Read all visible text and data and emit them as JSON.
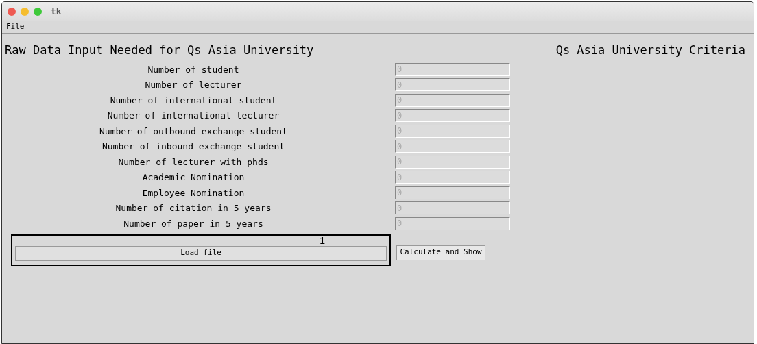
{
  "window": {
    "title": "tk"
  },
  "menu": [
    "File"
  ],
  "heading": "Raw Data Input Needed for Qs Asia University",
  "criteria_heading": "Qs Asia University Criteria",
  "fields": [
    {
      "label": "Number of student",
      "placeholder": "0"
    },
    {
      "label": "Number of lecturer",
      "placeholder": "0"
    },
    {
      "label": "Number of international student",
      "placeholder": "0"
    },
    {
      "label": "Number of international lecturer",
      "placeholder": "0"
    },
    {
      "label": "Number of outbound exchange student",
      "placeholder": "0"
    },
    {
      "label": "Number of inbound exchange student",
      "placeholder": "0"
    },
    {
      "label": "Number of lecturer with phds",
      "placeholder": "0"
    },
    {
      "label": "Academic Nomination",
      "placeholder": "0"
    },
    {
      "label": "Employee Nomination",
      "placeholder": "0"
    },
    {
      "label": "Number of citation in 5 years",
      "placeholder": "0"
    },
    {
      "label": "Number of paper in 5 years",
      "placeholder": "0"
    }
  ],
  "annotation": "1",
  "buttons": [
    "Load file",
    "Calculate and Show"
  ]
}
